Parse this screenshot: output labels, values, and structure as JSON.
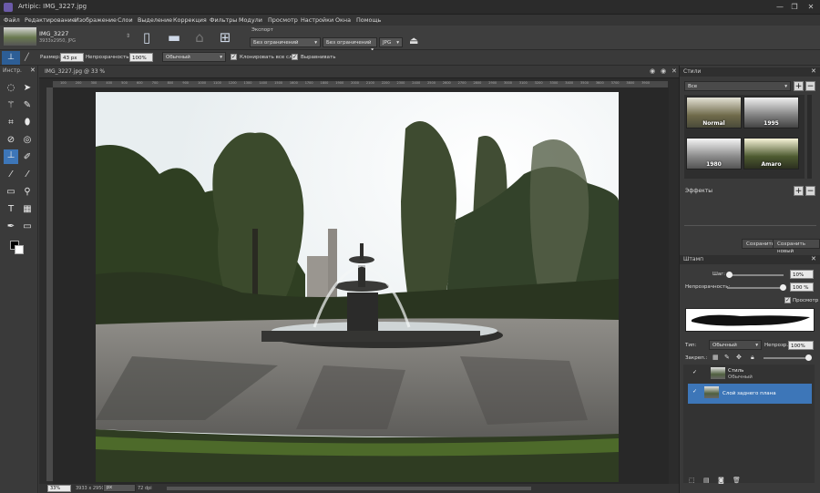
{
  "app": {
    "title": "Artipic: IMG_3227.jpg"
  },
  "menu": [
    "Файл",
    "Редактирование",
    "Изображение",
    "Слои",
    "Выделение",
    "Коррекция",
    "Фильтры",
    "Модули",
    "Просмотр",
    "Настройки",
    "Окна",
    "Помощь"
  ],
  "file": {
    "name": "IMG_3227",
    "info": "3933x2950, JPG"
  },
  "export": {
    "label": "Экспорт",
    "size_select_1": "Без ограничений",
    "size_select_2": "Без ограничений",
    "format": "JPG"
  },
  "options": {
    "size_label": "Размер:",
    "size_value": "43 px",
    "opacity_label": "Непрозрачность:",
    "opacity_value": "100%",
    "mode": "Обычный",
    "clone_all_label": "Клонировать все слои",
    "align_label": "Выравнивать"
  },
  "tools_panel": {
    "header": "Инстр."
  },
  "document": {
    "tab_label": "IMG_3227.jpg @ 33 %",
    "corner_info": "LE: pe:44.0(10 vp(1",
    "ruler_ticks": [
      "100",
      "200",
      "300",
      "400",
      "500",
      "600",
      "700",
      "800",
      "900",
      "1000",
      "1100",
      "1200",
      "1300",
      "1400",
      "1500",
      "1600",
      "1700",
      "1800",
      "1900",
      "2000",
      "2100",
      "2200",
      "2300",
      "2400",
      "2500",
      "2600",
      "2700",
      "2800",
      "2900",
      "3000",
      "3100",
      "3200",
      "3300",
      "3400",
      "3500",
      "3600",
      "3700",
      "3800",
      "3900"
    ]
  },
  "status": {
    "zoom": "33%",
    "dims": "3933 x 2950",
    "unit": "px",
    "dpi": "72 dpi"
  },
  "styles_panel": {
    "title": "Стили",
    "filter": "Все",
    "items": [
      "Normal",
      "1995",
      "1980",
      "Amaro"
    ],
    "effects_label": "Эффекты",
    "save_btn": "Сохранить",
    "save_new_btn": "Сохранить новый"
  },
  "stamp_panel": {
    "title": "Штамп",
    "step_label": "Шаг:",
    "step_value": "10%",
    "opacity_label": "Непрозрачность:",
    "opacity_value": "100 %",
    "preview_label": "Просмотр"
  },
  "layers_panel": {
    "type_label": "Тип:",
    "type_value": "Обычный",
    "opacity_label": "Непрозр.:",
    "opacity_value": "100%",
    "lock_label": "Закреп.:",
    "layers": [
      {
        "name": "Стиль",
        "sub": "Обычный"
      },
      {
        "name": "Слой заднего плана",
        "sub": ""
      }
    ]
  }
}
